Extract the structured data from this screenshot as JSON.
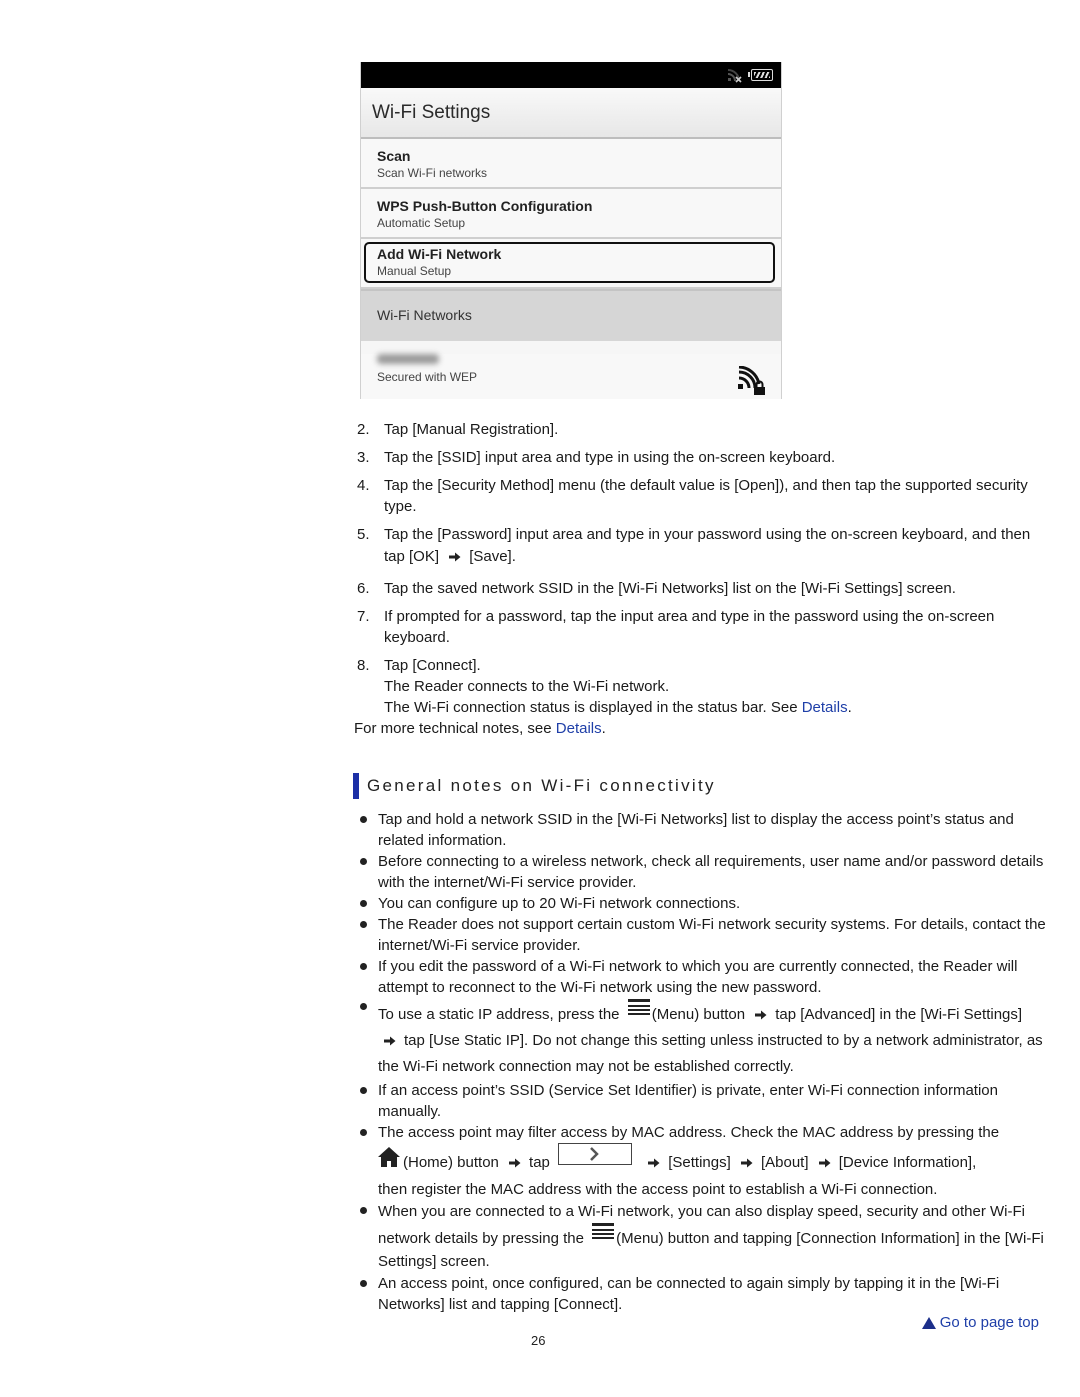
{
  "device": {
    "screen_title": "Wi-Fi Settings",
    "items": [
      {
        "title": "Scan",
        "subtitle": "Scan Wi-Fi networks"
      },
      {
        "title": "WPS Push-Button Configuration",
        "subtitle": "Automatic Setup"
      },
      {
        "title": "Add Wi-Fi Network",
        "subtitle": "Manual Setup"
      }
    ],
    "networks_header": "Wi-Fi Networks",
    "network": {
      "ssid_blurred": true,
      "security": "Secured with WEP"
    }
  },
  "steps": [
    {
      "num": "2.",
      "lines": [
        "Tap [Manual Registration]."
      ]
    },
    {
      "num": "3.",
      "lines": [
        "Tap the [SSID] input area and type in using the on-screen keyboard."
      ]
    },
    {
      "num": "4.",
      "lines": [
        "Tap the [Security Method] menu (the default value is [Open]), and then tap the supported security type."
      ]
    },
    {
      "num": "5.",
      "text_a": "Tap the [Password] input area and type in your password using the on-screen keyboard, and then tap [OK]",
      "text_b": "[Save]."
    },
    {
      "num": "6.",
      "lines": [
        "Tap the saved network SSID in the [Wi-Fi Networks] list on the [Wi-Fi Settings] screen."
      ]
    },
    {
      "num": "7.",
      "lines": [
        "If prompted for a password, tap the input area and type in the password using the on-screen keyboard."
      ]
    },
    {
      "num": "8.",
      "line1": "Tap [Connect].",
      "line2": "The Reader connects to the Wi-Fi network.",
      "line3": "The Wi-Fi connection status is displayed in the status bar. See ",
      "link": "Details",
      "line3_end": "."
    }
  ],
  "after_steps": {
    "text": "For more technical notes, see ",
    "link": "Details",
    "end": "."
  },
  "section": {
    "title": "General notes on Wi-Fi connectivity"
  },
  "notes": {
    "n1": "Tap and hold a network SSID in the [Wi-Fi Networks] list to display the access point’s status and related information.",
    "n2": "Before connecting to a wireless network, check all requirements, user name and/or password details with the internet/Wi-Fi service provider.",
    "n3": "You can configure up to 20 Wi-Fi network connections.",
    "n4": "The Reader does not support certain custom Wi-Fi network security systems. For details, contact the internet/Wi-Fi service provider.",
    "n5": "If you edit the password of a Wi-Fi network to which you are currently connected, the Reader will attempt to reconnect to the Wi-Fi network using the new password.",
    "n6": {
      "a": "To use a static IP address, press the",
      "b": "(Menu) button",
      "c": "tap [Advanced] in the [Wi-Fi Settings]",
      "d": "tap [Use Static IP]. Do not change this setting unless instructed to by a network administrator, as the Wi-Fi network connection may not be established correctly."
    },
    "n7": "If an access point’s SSID (Service Set Identifier) is private, enter Wi-Fi connection information manually.",
    "n8": {
      "a": "The access point may filter access by MAC address. Check the MAC address by pressing the",
      "b": "(Home) button",
      "c": "tap",
      "d": "[Settings]",
      "e": "[About]",
      "f": "[Device Information],",
      "g": "then register the MAC address with the access point to establish a Wi-Fi connection."
    },
    "n9": {
      "a": "When you are connected to a Wi-Fi network, you can also display speed, security and other Wi-Fi network details by pressing the",
      "b": "(Menu) button and tapping [Connection Information] in the [Wi-Fi Settings] screen."
    },
    "n10": "An access point, once configured, can be connected to again simply by tapping it in the [Wi-Fi Networks] list and tapping [Connect]."
  },
  "footer": {
    "page_top": "Go to page top",
    "page_number": "26"
  },
  "colors": {
    "link": "#1f3fa8",
    "heading_bar": "#1c2fa6"
  }
}
